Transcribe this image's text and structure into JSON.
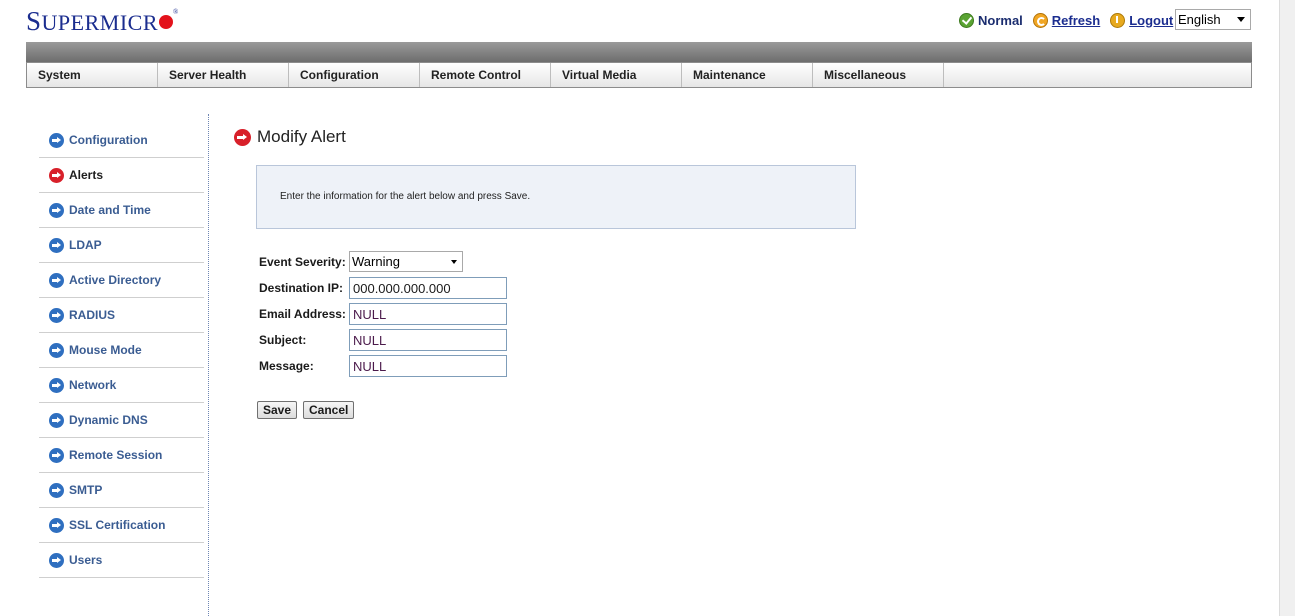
{
  "brand": {
    "logo_first": "S",
    "logo_rest": "UPERMICR",
    "logo_reg": "®",
    "logo_color": "#1b2d8f",
    "dot_color": "#e3121b"
  },
  "header": {
    "status_label": "Normal",
    "refresh_label": "Refresh",
    "logout_label": "Logout",
    "language_selected": "English"
  },
  "nav": {
    "tabs": [
      "System",
      "Server Health",
      "Configuration",
      "Remote Control",
      "Virtual Media",
      "Maintenance",
      "Miscellaneous"
    ]
  },
  "sidebar": {
    "items": [
      {
        "label": "Configuration",
        "icon": "arrow-right-blue-icon",
        "active": false
      },
      {
        "label": "Alerts",
        "icon": "arrow-right-red-icon",
        "active": true
      },
      {
        "label": "Date and Time",
        "icon": "arrow-right-blue-icon",
        "active": false
      },
      {
        "label": "LDAP",
        "icon": "arrow-right-blue-icon",
        "active": false
      },
      {
        "label": "Active Directory",
        "icon": "arrow-right-blue-icon",
        "active": false
      },
      {
        "label": "RADIUS",
        "icon": "arrow-right-blue-icon",
        "active": false
      },
      {
        "label": "Mouse Mode",
        "icon": "arrow-right-blue-icon",
        "active": false
      },
      {
        "label": "Network",
        "icon": "arrow-right-blue-icon",
        "active": false
      },
      {
        "label": "Dynamic DNS",
        "icon": "arrow-right-blue-icon",
        "active": false
      },
      {
        "label": "Remote Session",
        "icon": "arrow-right-blue-icon",
        "active": false
      },
      {
        "label": "SMTP",
        "icon": "arrow-right-blue-icon",
        "active": false
      },
      {
        "label": "SSL Certification",
        "icon": "arrow-right-blue-icon",
        "active": false
      },
      {
        "label": "Users",
        "icon": "arrow-right-blue-icon",
        "active": false
      }
    ]
  },
  "main": {
    "title": "Modify Alert",
    "info_text": "Enter the information for the alert below and press Save.",
    "form": {
      "event_severity_label": "Event Severity:",
      "event_severity_value": "Warning",
      "destination_ip_label": "Destination IP:",
      "destination_ip_value": "000.000.000.000",
      "email_label": "Email Address:",
      "email_value": "NULL",
      "subject_label": "Subject:",
      "subject_value": "NULL",
      "message_label": "Message:",
      "message_value": "NULL"
    },
    "save_label": "Save",
    "cancel_label": "Cancel"
  }
}
